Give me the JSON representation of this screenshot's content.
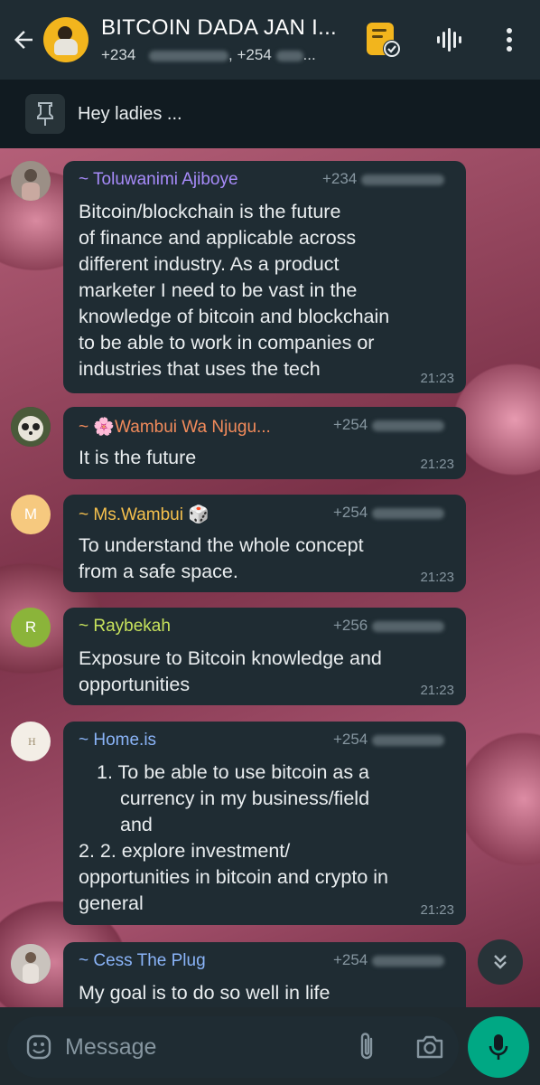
{
  "header": {
    "back_icon": "arrow-left-icon",
    "title": "BITCOIN DADA JAN I...",
    "subtitle_prefix": "+234",
    "subtitle_mid": ", +254",
    "subtitle_suffix": "...",
    "call_icon": "calendar-clock-icon",
    "voice_icon": "audio-wave-icon",
    "menu_icon": "more-vertical-icon"
  },
  "pinned": {
    "icon": "pin-icon",
    "text": "Hey ladies ..."
  },
  "messages": [
    {
      "sender": "~ Toluwanimi Ajiboye",
      "sender_color": "#a78bfa",
      "phone": "+234",
      "text_lines": [
        "Bitcoin/blockchain is the future",
        "of finance and applicable across",
        "different industry. As a product",
        "marketer I need to be vast in the",
        "knowledge of bitcoin and blockchain",
        "to be able to work in companies or",
        "industries that uses the tech"
      ],
      "time": "21:23"
    },
    {
      "sender": "~ 🌸Wambui Wa Njugu...",
      "sender_color": "#f28b5b",
      "phone": "+254",
      "text_lines": [
        "It is the future"
      ],
      "time": "21:23"
    },
    {
      "sender": "~ Ms.Wambui 🎲",
      "sender_color": "#f5c04d",
      "phone": "+254",
      "text_lines": [
        "To understand the whole concept",
        "from a safe space."
      ],
      "time": "21:23",
      "avatar_letter": "M",
      "avatar_color": "#f6c97f"
    },
    {
      "sender": "~ Raybekah",
      "sender_color": "#c7e25c",
      "phone": "+256",
      "text_lines": [
        "Exposure to Bitcoin knowledge and",
        "opportunities"
      ],
      "time": "21:23",
      "avatar_letter": "R",
      "avatar_color": "#8bb43a"
    },
    {
      "sender": "~ Home.is",
      "sender_color": "#8ab4f8",
      "phone": "+254",
      "list_1_a": "1. To be able to use bitcoin as a",
      "list_1_b": "currency in my business/field",
      "list_1_c": "and",
      "text_lines": [
        "2. 2. explore investment/",
        "opportunities in bitcoin and crypto in",
        "general"
      ],
      "time": "21:23"
    },
    {
      "sender": "~ Cess The Plug",
      "sender_color": "#8ab4f8",
      "phone": "+254",
      "text_lines": [
        "My goal is to do so well in life"
      ]
    }
  ],
  "composer": {
    "placeholder": "Message",
    "emoji_icon": "emoji-icon",
    "attach_icon": "paperclip-icon",
    "camera_icon": "camera-icon",
    "mic_icon": "microphone-icon",
    "scroll_icon": "double-chevron-down-icon"
  },
  "colors": {
    "header_bg": "#1f2c33",
    "bubble_bg": "#1f2c33",
    "accent": "#00a884",
    "meta_text": "#8696a0"
  }
}
